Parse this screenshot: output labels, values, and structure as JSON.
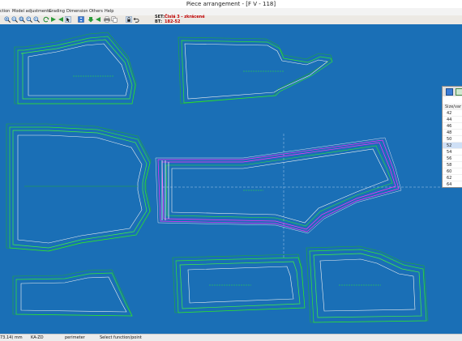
{
  "window": {
    "title": "Piece arrangement - [F V - 118]"
  },
  "menu": [
    "ction",
    "Model adjustments",
    "Grading",
    "Dimension",
    "Others",
    "Help"
  ],
  "toolbar": {
    "icons": [
      "zoom-in-icon",
      "zoom-out-icon",
      "zoom-window-icon",
      "zoom-previous-icon",
      "zoom-all-icon",
      "refresh-icon",
      "arrow-right-icon",
      "arrow-left-icon",
      "pointer-icon",
      "move-piece-icon",
      "arrow-down-icon",
      "print-icon",
      "copy-icon",
      "piece-lock-icon",
      "undo-icon"
    ],
    "set_label": "SET:",
    "set_value": "Čislá 3 - zkrácené",
    "bt_label": "BT:",
    "bt_value": "182-52"
  },
  "size_panel": {
    "header": "Size/var",
    "sizes": [
      "42",
      "44",
      "46",
      "48",
      "50",
      "52",
      "54",
      "56",
      "58",
      "60",
      "62",
      "64"
    ],
    "selected": "52"
  },
  "statusbar": {
    "coords": "73.14) mm",
    "mode": "KA-ZD",
    "measure": "perimeter",
    "prompt": "Select function/point"
  },
  "colors": {
    "workspace": "#1a6fb6",
    "grade_line_bright": "#2fe82f",
    "grade_line": "#1fae2f",
    "base_outline": "#f2f2f2",
    "highlight": "#ff2aff",
    "selected_size": "#cfe0f6"
  }
}
